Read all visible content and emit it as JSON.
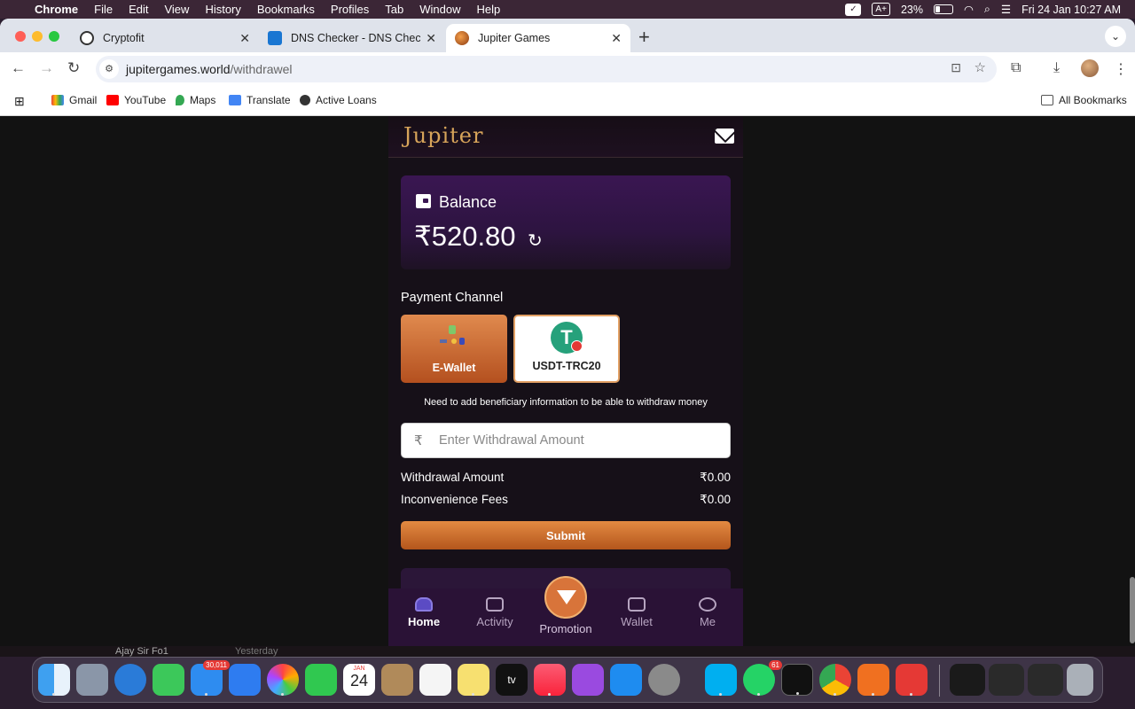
{
  "menubar": {
    "apple": "",
    "app_name": "Chrome",
    "items": [
      "File",
      "Edit",
      "View",
      "History",
      "Bookmarks",
      "Profiles",
      "Tab",
      "Window",
      "Help"
    ],
    "battery": "23%",
    "datetime": "Fri 24 Jan  10:27 AM"
  },
  "tabs": [
    {
      "title": "Cryptofit"
    },
    {
      "title": "DNS Checker - DNS Check Pr"
    },
    {
      "title": "Jupiter Games"
    }
  ],
  "omnibox": {
    "host": "jupitergames.world",
    "path": "/withdrawel"
  },
  "bookmarks": {
    "items": [
      "Gmail",
      "YouTube",
      "Maps",
      "Translate",
      "Active Loans"
    ],
    "all": "All Bookmarks"
  },
  "app": {
    "logo": "Jupiter",
    "balance_title": "Balance",
    "balance_amount": "₹520.80",
    "payment_channel_label": "Payment Channel",
    "channels": [
      {
        "label": "E-Wallet"
      },
      {
        "label": "USDT-TRC20"
      }
    ],
    "note": "Need to add beneficiary information to be able to withdraw money",
    "amount_currency": "₹",
    "amount_placeholder": "Enter Withdrawal Amount",
    "withdrawal_amount_label": "Withdrawal Amount",
    "withdrawal_amount_value": "₹0.00",
    "fees_label": "Inconvenience Fees",
    "fees_value": "₹0.00",
    "submit_label": "Submit",
    "nav": [
      {
        "label": "Home"
      },
      {
        "label": "Activity"
      },
      {
        "label": "Promotion"
      },
      {
        "label": "Wallet"
      },
      {
        "label": "Me"
      }
    ]
  },
  "peek": {
    "text": "Ajay Sir Fo1",
    "time": "Yesterday"
  },
  "dock": {
    "mail_badge": "30,011",
    "calendar_month": "JAN",
    "calendar_day": "24",
    "whatsapp_badge": "61",
    "tv_label": "tv"
  }
}
